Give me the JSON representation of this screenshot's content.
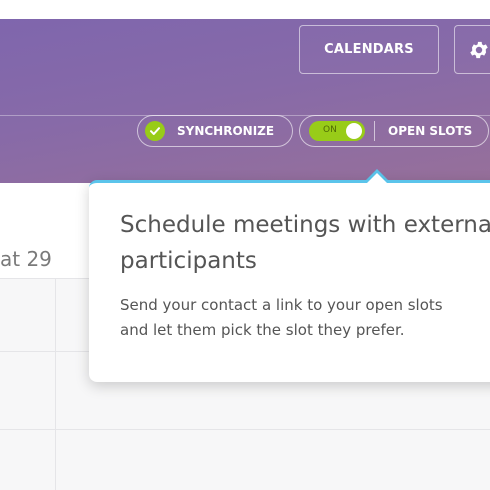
{
  "header": {
    "calendars_label": "CALENDARS",
    "settings_icon": "gear-icon",
    "synchronize_label": "SYNCHRONIZE",
    "synchronize_icon": "check-icon",
    "toggle_label": "ON",
    "toggle_state": "on",
    "open_slots_label": "OPEN SLOTS"
  },
  "calendar": {
    "date_label": "at 29"
  },
  "popover": {
    "title_line1": "Schedule meetings with externa",
    "title_line2": "participants",
    "body_line1": "Send your contact a link to your open slots",
    "body_line2": "and let them pick the slot they prefer."
  },
  "colors": {
    "header_gradient_start": "#7f66ad",
    "header_gradient_end": "#97709a",
    "accent_green": "#98cc18",
    "popover_accent": "#5bc4eb"
  }
}
